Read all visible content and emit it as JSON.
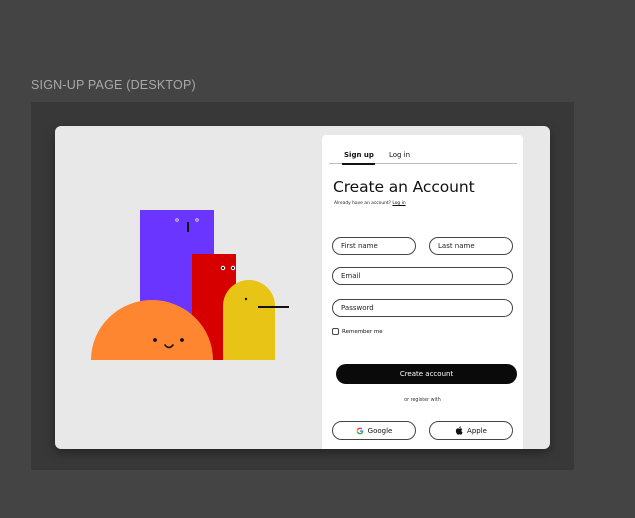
{
  "frame": {
    "label": "SIGN-UP PAGE (DESKTOP)"
  },
  "tabs": [
    {
      "label": "Sign up",
      "active": true
    },
    {
      "label": "Log in",
      "active": false
    }
  ],
  "form": {
    "title": "Create an Account",
    "already_text": "Already have an account?",
    "login_link": "Log in",
    "first_name_placeholder": "First name",
    "last_name_placeholder": "Last name",
    "email_placeholder": "Email",
    "password_placeholder": "Password",
    "remember_label": "Remember me",
    "submit_label": "Create account",
    "or_text": "or register with",
    "google_label": "Google",
    "apple_label": "Apple"
  },
  "icons": [
    "google-icon",
    "apple-icon"
  ],
  "colors": {
    "purple": "#6a36ff",
    "red": "#d60000",
    "yellow": "#e8c416",
    "orange": "#ff8630",
    "button": "#0a0a0a",
    "card": "#e8e8e8",
    "canvas": "#444444"
  }
}
